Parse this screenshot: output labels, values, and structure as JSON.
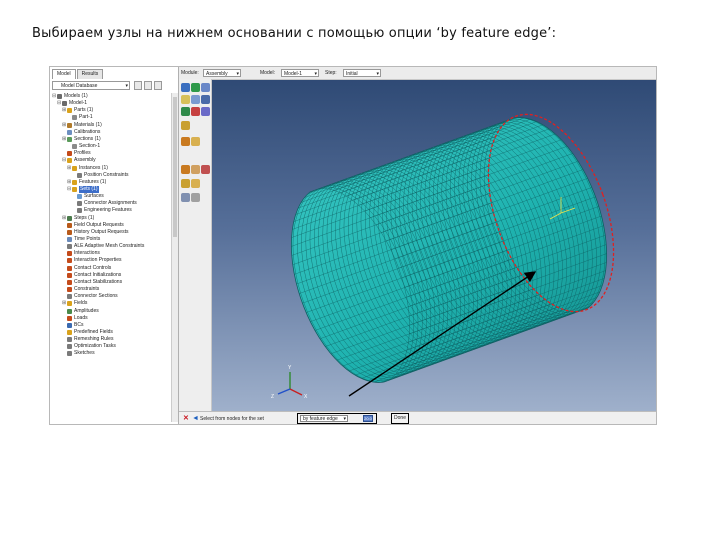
{
  "slide": {
    "title": "Выбираем узлы на нижнем основании с помощью опции ‘by feature edge’:"
  },
  "tree_panel": {
    "tabs": [
      "Model",
      "Results"
    ],
    "db_select": "Model Database",
    "items": [
      {
        "label": "Models (1)",
        "level": 0,
        "exp": "⊟",
        "color": "#6a6a6a"
      },
      {
        "label": "Model-1",
        "level": 1,
        "exp": "⊟",
        "color": "#6a6a6a"
      },
      {
        "label": "Parts (1)",
        "level": 2,
        "exp": "⊞",
        "color": "#d9a21b"
      },
      {
        "label": "Part-1",
        "level": 3,
        "exp": "",
        "color": "#8a8a8a"
      },
      {
        "label": "Materials (1)",
        "level": 2,
        "exp": "⊞",
        "color": "#b07a2a"
      },
      {
        "label": "Calibrations",
        "level": 2,
        "exp": "",
        "color": "#6d8fc0"
      },
      {
        "label": "Sections (1)",
        "level": 2,
        "exp": "⊞",
        "color": "#5a9a5a"
      },
      {
        "label": "Section-1",
        "level": 3,
        "exp": "",
        "color": "#8a8a8a"
      },
      {
        "label": "Profiles",
        "level": 2,
        "exp": "",
        "color": "#c44b1b"
      },
      {
        "label": "Assembly",
        "level": 2,
        "exp": "⊟",
        "color": "#d9a21b"
      },
      {
        "label": "Instances (1)",
        "level": 3,
        "exp": "⊞",
        "color": "#d9a21b"
      },
      {
        "label": "Position Constraints",
        "level": 4,
        "exp": "",
        "color": "#7a7a7a"
      },
      {
        "label": "Features (1)",
        "level": 3,
        "exp": "⊞",
        "color": "#d9a21b"
      },
      {
        "label": "Sets (1)",
        "level": 3,
        "exp": "⊟",
        "color": "#d9a21b",
        "selected": true
      },
      {
        "label": "Surfaces",
        "level": 4,
        "exp": "",
        "color": "#6a9ad0"
      },
      {
        "label": "Connector Assignments",
        "level": 4,
        "exp": "",
        "color": "#7a7a7a"
      },
      {
        "label": "Engineering Features",
        "level": 4,
        "exp": "",
        "color": "#7a7a7a"
      },
      {
        "label": "Steps (1)",
        "level": 2,
        "exp": "⊞",
        "color": "#4a7a4a"
      },
      {
        "label": "Field Output Requests",
        "level": 2,
        "exp": "",
        "color": "#b85a1a"
      },
      {
        "label": "History Output Requests",
        "level": 2,
        "exp": "",
        "color": "#b85a1a"
      },
      {
        "label": "Time Points",
        "level": 2,
        "exp": "",
        "color": "#6a8aba"
      },
      {
        "label": "ALE Adaptive Mesh Constraints",
        "level": 2,
        "exp": "",
        "color": "#7a7a7a"
      },
      {
        "label": "Interactions",
        "level": 2,
        "exp": "",
        "color": "#c44b1b"
      },
      {
        "label": "Interaction Properties",
        "level": 2,
        "exp": "",
        "color": "#c44b1b"
      },
      {
        "label": "Contact Controls",
        "level": 2,
        "exp": "",
        "color": "#c44b1b"
      },
      {
        "label": "Contact Initializations",
        "level": 2,
        "exp": "",
        "color": "#c44b1b"
      },
      {
        "label": "Contact Stabilizations",
        "level": 2,
        "exp": "",
        "color": "#c44b1b"
      },
      {
        "label": "Constraints",
        "level": 2,
        "exp": "",
        "color": "#c44b1b"
      },
      {
        "label": "Connector Sections",
        "level": 2,
        "exp": "",
        "color": "#7a7a7a"
      },
      {
        "label": "Fields",
        "level": 2,
        "exp": "⊞",
        "color": "#d9a21b"
      },
      {
        "label": "Amplitudes",
        "level": 2,
        "exp": "",
        "color": "#4a8a4a"
      },
      {
        "label": "Loads",
        "level": 2,
        "exp": "",
        "color": "#c44b1b"
      },
      {
        "label": "BCs",
        "level": 2,
        "exp": "",
        "color": "#3a6ab0"
      },
      {
        "label": "Predefined Fields",
        "level": 2,
        "exp": "",
        "color": "#d9a21b"
      },
      {
        "label": "Remeshing Rules",
        "level": 2,
        "exp": "",
        "color": "#7a7a7a"
      },
      {
        "label": "Optimization Tasks",
        "level": 2,
        "exp": "",
        "color": "#7a7a7a"
      },
      {
        "label": "Sketches",
        "level": 2,
        "exp": "",
        "color": "#7a7a7a"
      }
    ]
  },
  "context_bar": {
    "module_label": "Module:",
    "module_value": "Assembly",
    "model_label": "Model:",
    "model_value": "Model-1",
    "step_label": "Step:",
    "step_value": "Initial"
  },
  "prompt_bar": {
    "text": "Select from nodes for the set",
    "method_value": "by feature edge",
    "angle_button": "20.0",
    "done_label": "Done"
  },
  "viewport": {
    "mesh_color": "#1fb3b0",
    "mesh_line_color": "#0e5f62",
    "highlight_color": "#e02020",
    "annotation_color": "#000000"
  },
  "triad": {
    "x_label": "X",
    "y_label": "Y",
    "z_label": "Z"
  }
}
